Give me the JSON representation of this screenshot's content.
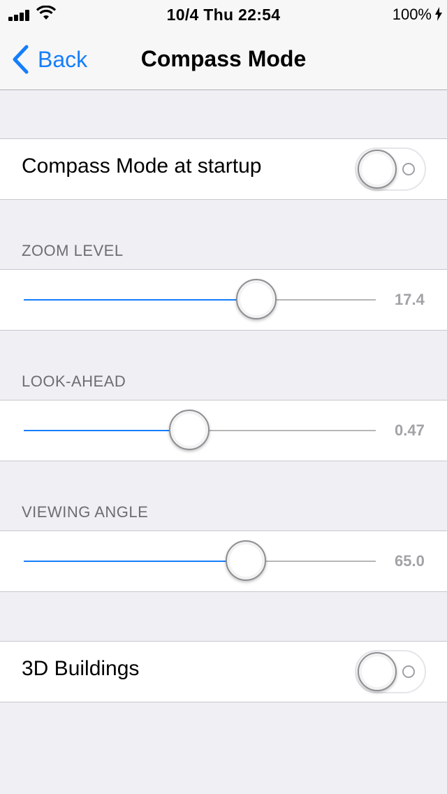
{
  "status_bar": {
    "time": "10/4 Thu 22:54",
    "battery": "100%",
    "signal_icon": "cellular-signal-icon",
    "wifi_icon": "wifi-icon",
    "charging_icon": "charging-bolt-icon"
  },
  "nav": {
    "back_label": "Back",
    "title": "Compass Mode",
    "back_icon": "chevron-left-icon"
  },
  "compass_startup": {
    "label": "Compass Mode at startup",
    "on": false
  },
  "zoom": {
    "header": "ZOOM LEVEL",
    "value_text": "17.4",
    "fraction": 0.66
  },
  "look_ahead": {
    "header": "LOOK-AHEAD",
    "value_text": "0.47",
    "fraction": 0.47
  },
  "viewing_angle": {
    "header": "VIEWING ANGLE",
    "value_text": "65.0",
    "fraction": 0.63
  },
  "buildings": {
    "label": "3D Buildings",
    "on": false
  },
  "colors": {
    "accent": "#157EFB",
    "background": "#EFEFF4",
    "section_header": "#6D6D72"
  }
}
